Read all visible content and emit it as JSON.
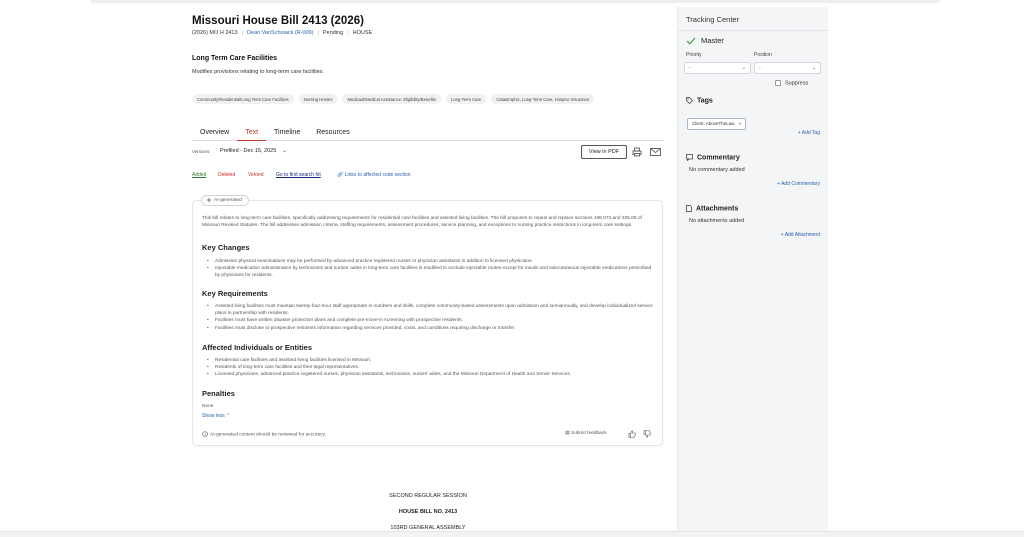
{
  "bill": {
    "title": "Missouri House Bill 2413 (2026)",
    "code": "(2026) MO H 2413",
    "sponsor": "Dean VanSchoiack (R-009)",
    "status": "Pending",
    "chamber": "HOUSE"
  },
  "subject": {
    "title": "Long Term Care Facilities",
    "description": "Modifies provisions relating to long-term care facilities."
  },
  "chips": [
    "Community/Residential/Long Term Care Facilities",
    "Nursing Homes",
    "Medicaid/Medical Assistance: Eligibility/Benefits",
    "Long-Term Care",
    "Catastrophic, Long-Term Care, Hospice Insurance"
  ],
  "tabs": [
    "Overview",
    "Text",
    "Timeline",
    "Resources"
  ],
  "active_tab": "Text",
  "versions": {
    "label": "Versions:",
    "selected": "Prefiled - Dec 15, 2025",
    "view_pdf": "View in PDF"
  },
  "legend": {
    "added": "Added",
    "deleted": "Deleted",
    "vetoed": "Vetoed",
    "first_hit": "Go to first search hit",
    "links": "Links to affected code section"
  },
  "ai": {
    "badge": "AI-generated",
    "summary": "This bill relates to long-term care facilities, specifically addressing requirements for residential care facilities and assisted living facilities. The bill proposes to repeal and replace sections 198.073 and 335.08 of Missouri Revised Statutes. The bill addresses admission criteria, staffing requirements, assessment procedures, service planning, and exceptions to nursing practice restrictions in long-term care settings.",
    "sections": [
      {
        "heading": "Key Changes",
        "items": [
          "Admission physical examinations may be performed by advanced practice registered nurses or physician assistants in addition to licensed physicians.",
          "Injectable medication administration by technicians and nurses' aides in long-term care facilities is modified to exclude injectable routes except for insulin and subcutaneous injectable medications prescribed by physicians for residents."
        ]
      },
      {
        "heading": "Key Requirements",
        "items": [
          "Assisted living facilities must maintain twenty-four-hour staff appropriate in numbers and skills, complete community-based assessments upon admission and semiannually, and develop individualized service plans in partnership with residents.",
          "Facilities must have written disaster protection plans and complete pre-move-in screening with prospective residents.",
          "Facilities must disclose to prospective residents information regarding services provided, costs, and conditions requiring discharge or transfer."
        ]
      },
      {
        "heading": "Affected Individuals or Entities",
        "items": [
          "Residential care facilities and assisted living facilities licensed in Missouri.",
          "Residents of long-term care facilities and their legal representatives.",
          "Licensed physicians, advanced practice registered nurses, physician assistants, technicians, nurses' aides, and the Missouri Department of Health and Senior Services."
        ]
      },
      {
        "heading": "Penalties",
        "items": []
      }
    ],
    "penalties_none": "None",
    "show_less": "Show less",
    "disclaimer": "AI-generated content should be reviewed for accuracy.",
    "submit_feedback": "Submit feedback"
  },
  "document": {
    "line1": "SECOND REGULAR SESSION",
    "line2": "HOUSE BILL NO. 2413",
    "line3": "103RD GENERAL ASSEMBLY"
  },
  "sidebar": {
    "title": "Tracking Center",
    "master": "Master",
    "priority_label": "Priority",
    "position_label": "Position",
    "priority_value": "-",
    "position_value": "-",
    "suppress": "Suppress",
    "tags_heading": "Tags",
    "tag": "Client: AboveTheLaw",
    "add_tag": "+ Add Tag",
    "commentary_heading": "Commentary",
    "no_commentary": "No commentary added",
    "add_commentary": "+ Add Commentary",
    "attachments_heading": "Attachments",
    "no_attachments": "No attachments added",
    "add_attachment": "+ Add Attachment"
  },
  "colors": {
    "accent_red": "#c0392b",
    "link_blue": "#2a5fb0",
    "added_green": "#2e7d32",
    "check_green": "#3a9d3a"
  }
}
